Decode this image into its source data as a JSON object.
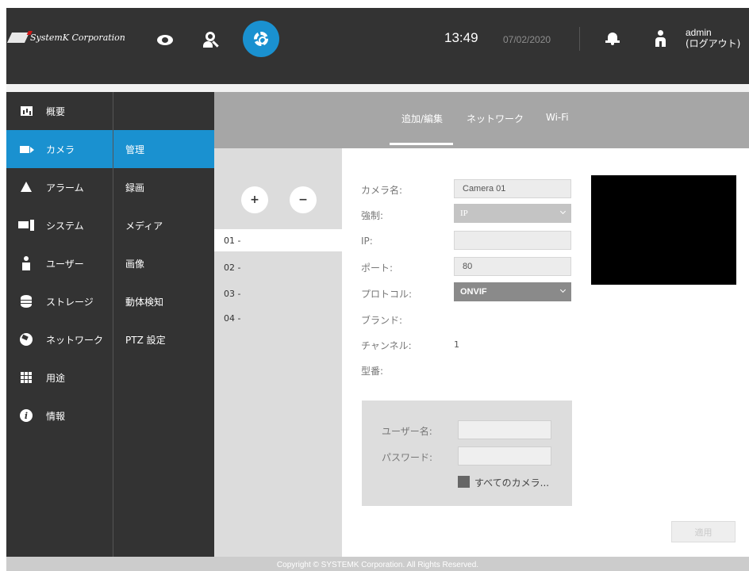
{
  "header": {
    "company": "SystemK Corporation",
    "time": "13:49",
    "date": "07/02/2020",
    "user_name": "admin",
    "logout_label": "(ログアウト)",
    "accent_color": "#1a91d0"
  },
  "nav_primary": [
    {
      "label": "概要",
      "icon": "chart-bar-icon"
    },
    {
      "label": "カメラ",
      "icon": "video-camera-icon",
      "active": true
    },
    {
      "label": "アラーム",
      "icon": "bell-icon"
    },
    {
      "label": "システム",
      "icon": "computer-icon"
    },
    {
      "label": "ユーザー",
      "icon": "user-icon"
    },
    {
      "label": "ストレージ",
      "icon": "database-icon"
    },
    {
      "label": "ネットワーク",
      "icon": "globe-icon"
    },
    {
      "label": "用途",
      "icon": "grid-icon"
    },
    {
      "label": "情報",
      "icon": "info-icon"
    }
  ],
  "nav_secondary": [
    {
      "label": "管理",
      "active": true
    },
    {
      "label": "録画"
    },
    {
      "label": "メディア"
    },
    {
      "label": "画像"
    },
    {
      "label": "動体検知"
    },
    {
      "label": "PTZ 設定"
    }
  ],
  "tabs": [
    {
      "label": "追加/編集",
      "active": true
    },
    {
      "label": "ネットワーク"
    },
    {
      "label": "Wi-Fi"
    }
  ],
  "camera_list": {
    "add_label": "+",
    "remove_label": "−",
    "items": [
      "01 -",
      "02 -",
      "03 -",
      "04 -"
    ],
    "selected": "01 -"
  },
  "form": {
    "camera_name_label": "カメラ名:",
    "camera_name_value": "Camera 01",
    "force_label": "強制:",
    "force_value": "IP",
    "ip_label": "IP:",
    "ip_value": "",
    "port_label": "ポート:",
    "port_value": "80",
    "protocol_label": "プロトコル:",
    "protocol_value": "ONVIF",
    "brand_label": "ブランド:",
    "channel_label": "チャンネル:",
    "channel_value": "1",
    "model_label": "型番:",
    "username_label": "ユーザー名:",
    "password_label": "パスワード:",
    "all_cameras_label": "すべてのカメラ..."
  },
  "apply_label": "適用",
  "footer": "Copyright © SYSTEMK Corporation. All Rights Reserved."
}
